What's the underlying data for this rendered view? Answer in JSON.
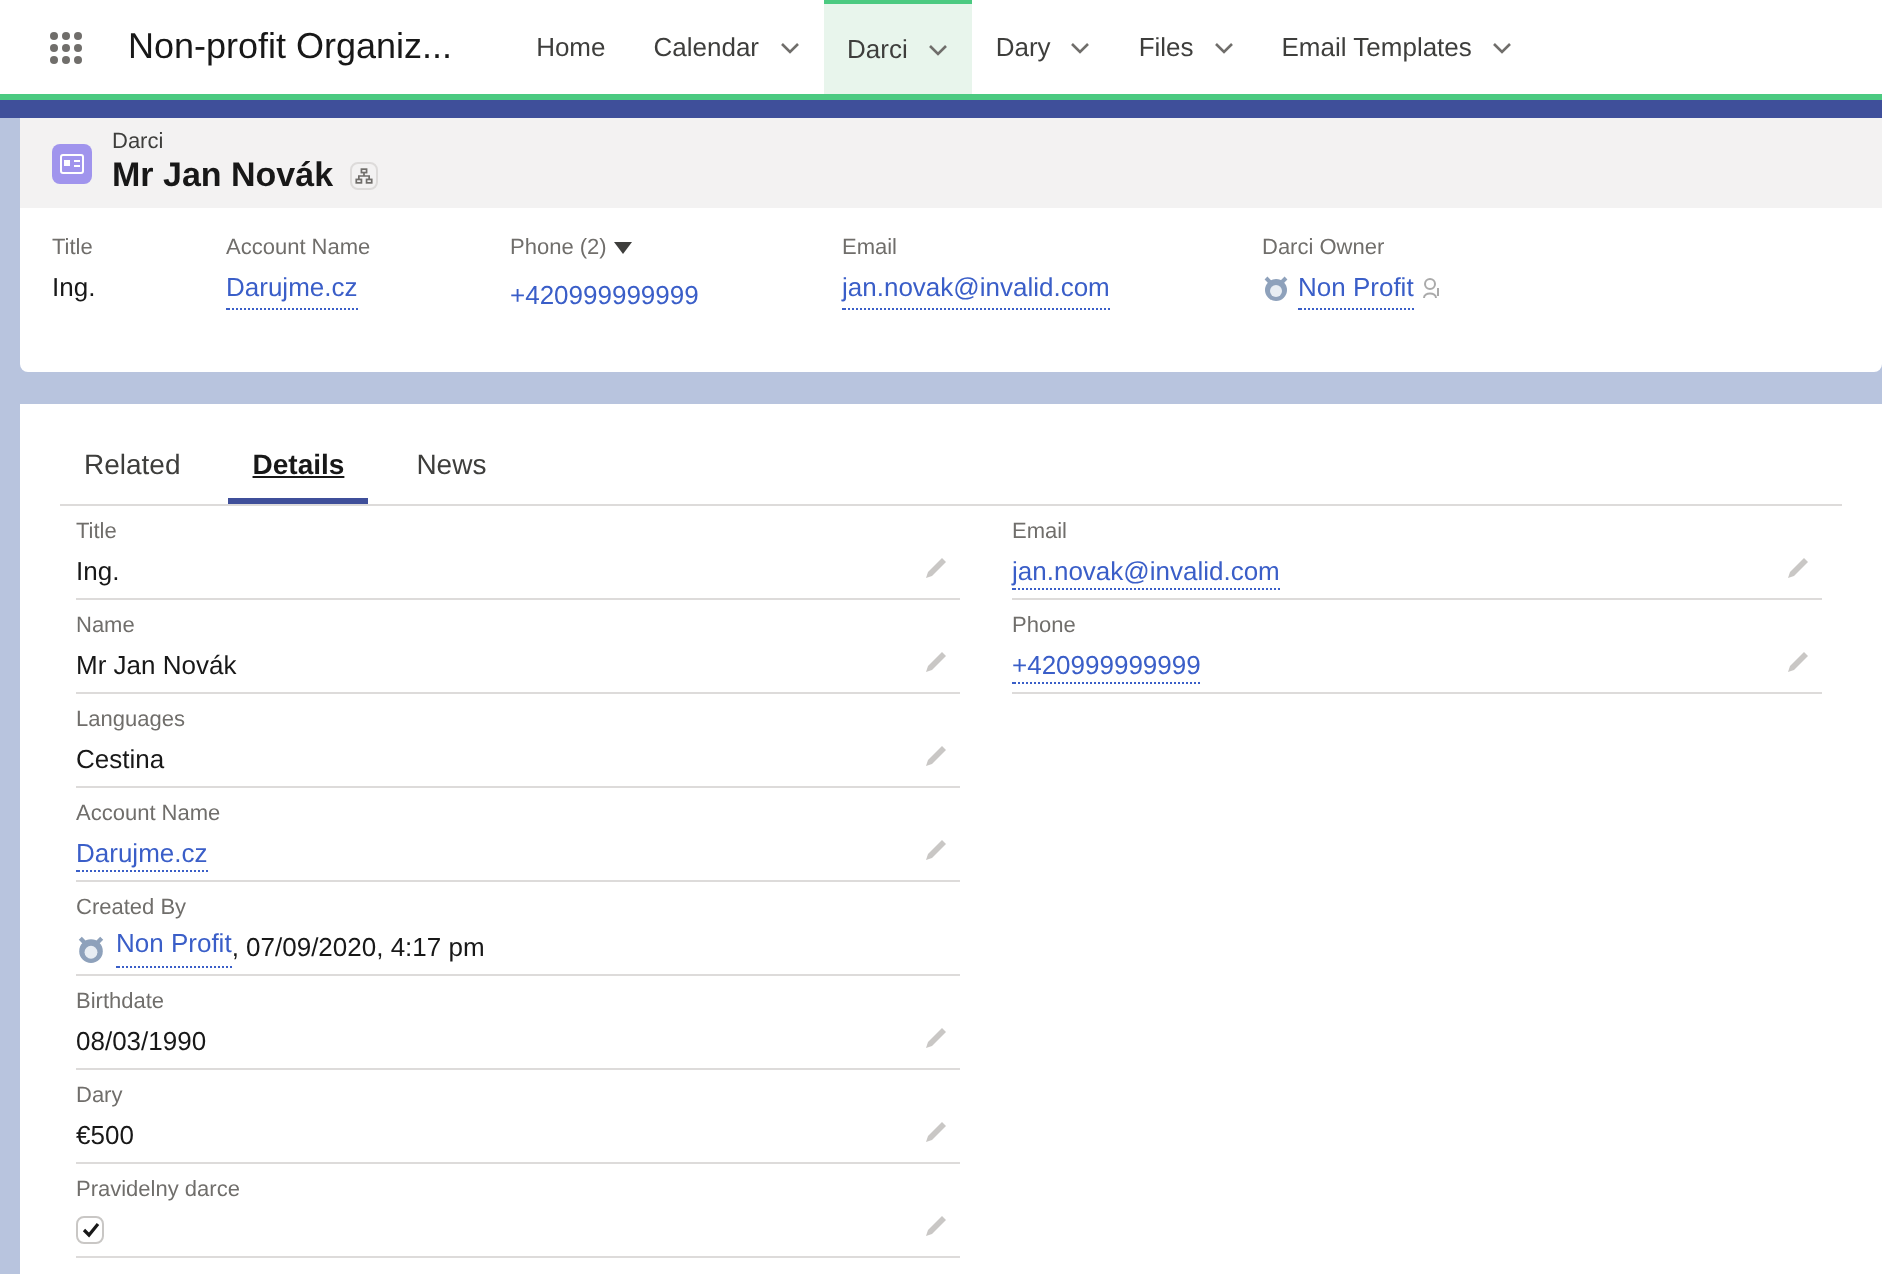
{
  "app_name": "Non-profit Organiz...",
  "nav": [
    {
      "label": "Home",
      "menu": false,
      "selected": false
    },
    {
      "label": "Calendar",
      "menu": true,
      "selected": false
    },
    {
      "label": "Darci",
      "menu": true,
      "selected": true
    },
    {
      "label": "Dary",
      "menu": true,
      "selected": false
    },
    {
      "label": "Files",
      "menu": true,
      "selected": false
    },
    {
      "label": "Email Templates",
      "menu": true,
      "selected": false
    }
  ],
  "record": {
    "object": "Darci",
    "name": "Mr Jan Novák"
  },
  "highlights": [
    {
      "label": "Title",
      "value": "Ing.",
      "kind": "text"
    },
    {
      "label": "Account Name",
      "value": "Darujme.cz",
      "kind": "link"
    },
    {
      "label": "Phone (2)",
      "value": "+420999999999",
      "kind": "phone"
    },
    {
      "label": "Email",
      "value": "jan.novak@invalid.com",
      "kind": "link"
    },
    {
      "label": "Darci Owner",
      "value": "Non Profit",
      "kind": "user"
    }
  ],
  "tabs": [
    {
      "label": "Related",
      "selected": false
    },
    {
      "label": "Details",
      "selected": true
    },
    {
      "label": "News",
      "selected": false
    }
  ],
  "left_fields": [
    {
      "label": "Title",
      "value": "Ing.",
      "kind": "text"
    },
    {
      "label": "Name",
      "value": "Mr Jan Novák",
      "kind": "text"
    },
    {
      "label": "Languages",
      "value": "Cestina",
      "kind": "text"
    },
    {
      "label": "Account Name",
      "value": "Darujme.cz",
      "kind": "link"
    },
    {
      "label": "Created By",
      "value": "Non Profit",
      "extra": ", 07/09/2020, 4:17 pm",
      "kind": "user"
    },
    {
      "label": "Birthdate",
      "value": "08/03/1990",
      "kind": "text"
    },
    {
      "label": "Dary",
      "value": "€500",
      "kind": "text"
    },
    {
      "label": "Pravidelny darce",
      "checked": true,
      "kind": "checkbox"
    }
  ],
  "right_fields": [
    {
      "label": "Email",
      "value": "jan.novak@invalid.com",
      "kind": "link"
    },
    {
      "label": "Phone",
      "value": "+420999999999",
      "kind": "link"
    }
  ]
}
